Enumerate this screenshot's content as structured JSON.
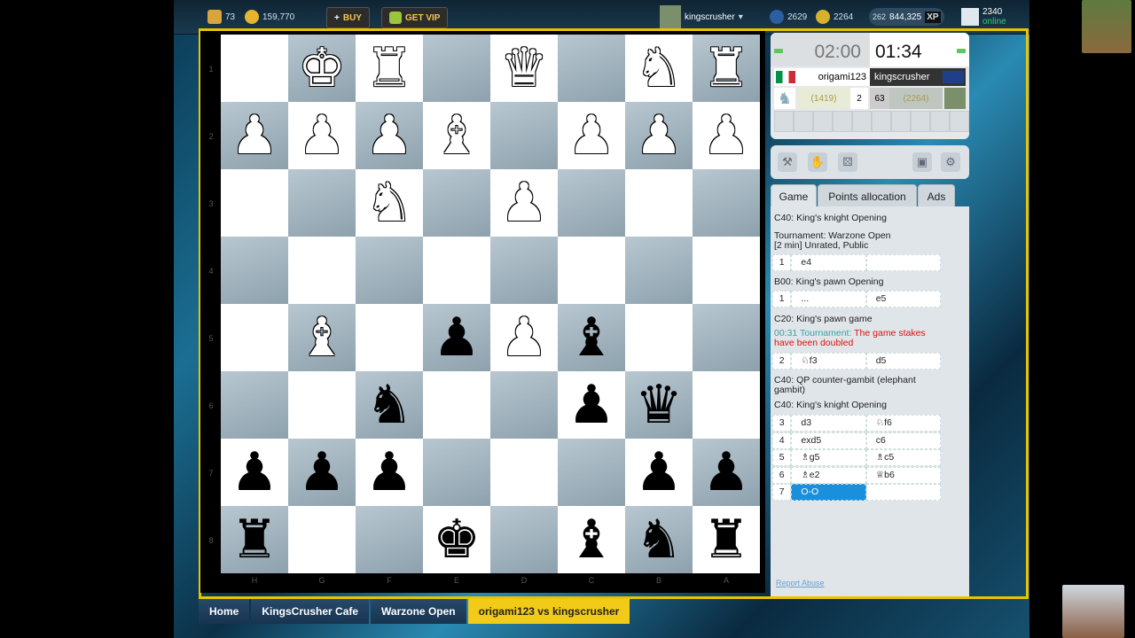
{
  "topbar": {
    "crowns": "73",
    "coins": "159,770",
    "buy_label": "BUY",
    "vip_label": "GET VIP",
    "username": "kingscrusher",
    "blitz_rating": "2629",
    "trophy_rating": "2264",
    "xp_level": "262",
    "xp_value": "844,325",
    "xp_badge": "XP",
    "online_count": "2340",
    "online_label": "online"
  },
  "board": {
    "rank_labels": [
      "1",
      "2",
      "3",
      "4",
      "5",
      "6",
      "7",
      "8"
    ],
    "file_labels": [
      "H",
      "G",
      "F",
      "E",
      "D",
      "C",
      "B",
      "A"
    ],
    "rows": [
      [
        "",
        "wK",
        "wR",
        "",
        "wQ",
        "",
        "wN",
        "wR"
      ],
      [
        "wP",
        "wP",
        "wP",
        "wB",
        "",
        "wP",
        "wP",
        "wP"
      ],
      [
        "",
        "",
        "wN",
        "",
        "wP",
        "",
        "",
        ""
      ],
      [
        "",
        "",
        "",
        "",
        "",
        "",
        "",
        ""
      ],
      [
        "",
        "wB",
        "",
        "bP",
        "wP",
        "bB",
        "",
        ""
      ],
      [
        "",
        "",
        "bN",
        "",
        "",
        "bP",
        "bQ",
        ""
      ],
      [
        "bP",
        "bP",
        "bP",
        "",
        "",
        "",
        "bP",
        "bP"
      ],
      [
        "bR",
        "",
        "",
        "bK",
        "",
        "bB",
        "bN",
        "bR"
      ]
    ]
  },
  "clock": {
    "white_time": "02:00",
    "black_time": "01:34",
    "white_name": "origami123",
    "black_name": "kingscrusher",
    "white_rating": "(1419)",
    "white_score": "2",
    "black_score": "63",
    "black_rating": "(2264)"
  },
  "tabs": [
    "Game",
    "Points allocation",
    "Ads"
  ],
  "game": {
    "opening_title": "C40: King's knight Opening",
    "tournament_line1": "Tournament: Warzone Open",
    "tournament_line2": "[2 min] Unrated, Public",
    "move1_n": "1",
    "move1_w": "e4",
    "move1_b": "",
    "b00": "B00: King's pawn Opening",
    "move1b_n": "1",
    "move1b_w": "...",
    "move1b_b": "e5",
    "c20": "C20: King's pawn game",
    "notice_time": "00:31",
    "notice_tournament": "Tournament:",
    "notice_text1": "The game stakes",
    "notice_text2": "have been doubled",
    "move2_n": "2",
    "move2_w": "♘f3",
    "move2_b": "d5",
    "c40qp1": "C40: QP counter-gambit (elephant",
    "c40qp2": "gambit)",
    "c40kk": "C40: King's knight Opening",
    "moves": [
      {
        "n": "3",
        "w": "d3",
        "b": "♘f6"
      },
      {
        "n": "4",
        "w": "exd5",
        "b": "c6"
      },
      {
        "n": "5",
        "w": "♗g5",
        "b": "♗c5"
      },
      {
        "n": "6",
        "w": "♗e2",
        "b": "♕b6"
      },
      {
        "n": "7",
        "w": "O-O",
        "b": ""
      }
    ],
    "report_abuse": "Report Abuse"
  },
  "bottom_tabs": [
    "Home",
    "KingsCrusher Cafe",
    "Warzone Open",
    "origami123 vs kingscrusher"
  ],
  "colors": {
    "accent": "#e8c400",
    "selected_move": "#1a8fdb",
    "notice_red": "#e01010"
  }
}
